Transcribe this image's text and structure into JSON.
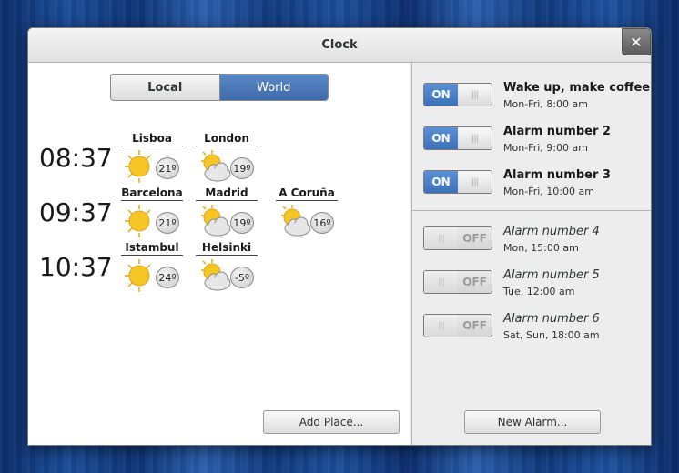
{
  "window": {
    "title": "Clock",
    "close_label": "✕"
  },
  "mode_tabs": {
    "local": "Local",
    "world": "World",
    "selected": "World"
  },
  "clocks": [
    {
      "time": "08:37",
      "places": [
        {
          "name": "Lisboa",
          "weather": "sunny",
          "temp": "21º"
        },
        {
          "name": "London",
          "weather": "partly-cloudy",
          "temp": "19º"
        }
      ]
    },
    {
      "time": "09:37",
      "places": [
        {
          "name": "Barcelona",
          "weather": "sunny",
          "temp": "21º"
        },
        {
          "name": "Madrid",
          "weather": "partly-cloudy",
          "temp": "19º"
        },
        {
          "name": "A Coruña",
          "weather": "partly-cloudy",
          "temp": "16º"
        }
      ]
    },
    {
      "time": "10:37",
      "places": [
        {
          "name": "Istambul",
          "weather": "sunny",
          "temp": "24º"
        },
        {
          "name": "Helsinki",
          "weather": "partly-cloudy",
          "temp": "-5º"
        }
      ]
    }
  ],
  "add_place_label": "Add Place...",
  "alarms": [
    {
      "name": "Wake up, make coffee",
      "schedule": "Mon-Fri, 8:00 am",
      "state": "ON"
    },
    {
      "name": "Alarm number 2",
      "schedule": "Mon-Fri, 9:00 am",
      "state": "ON"
    },
    {
      "name": "Alarm number 3",
      "schedule": "Mon-Fri, 10:00 am",
      "state": "ON"
    },
    {
      "name": "Alarm number 4",
      "schedule": "Mon, 15:00 am",
      "state": "OFF"
    },
    {
      "name": "Alarm number 5",
      "schedule": "Tue, 12:00 am",
      "state": "OFF"
    },
    {
      "name": "Alarm number 6",
      "schedule": "Sat, Sun, 18:00 am",
      "state": "OFF"
    }
  ],
  "switch_knob_glyph": "|||",
  "new_alarm_label": "New Alarm...",
  "colors": {
    "accent": "#4a7bc0",
    "sun": "#f6c624",
    "cloud": "#d6d6d6"
  }
}
